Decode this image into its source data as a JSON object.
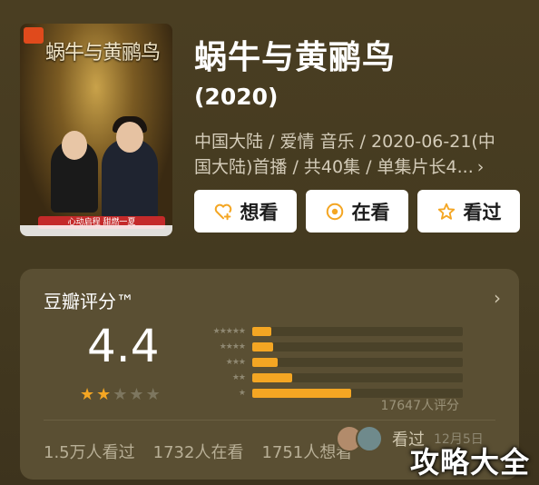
{
  "movie": {
    "title": "蜗牛与黄鹂鸟",
    "year": "(2020)",
    "meta_line1": "中国大陆 / 爱情 音乐 / 2020-06-21(中",
    "meta_line2": "国大陆)首播 / 共40集 / 单集片长4...",
    "meta_more_icon": "chevron-right-icon",
    "poster": {
      "title_text": "蜗牛与黄鹂鸟",
      "tagline": "心动启程 甜燃一夏"
    }
  },
  "actions": [
    {
      "label": "想看",
      "icon": "heart-plus-icon"
    },
    {
      "label": "在看",
      "icon": "target-icon"
    },
    {
      "label": "看过",
      "icon": "star-outline-icon"
    }
  ],
  "rating": {
    "title": "豆瓣评分™",
    "score": "4.4",
    "stars_filled": 2,
    "stars_total": 5,
    "distribution": [
      {
        "stars": 5,
        "fraction": 0.09
      },
      {
        "stars": 4,
        "fraction": 0.1
      },
      {
        "stars": 3,
        "fraction": 0.12
      },
      {
        "stars": 2,
        "fraction": 0.19
      },
      {
        "stars": 1,
        "fraction": 0.47
      }
    ],
    "count": "17647人评分",
    "colors": {
      "accent": "#f4a623"
    }
  },
  "stats": {
    "wished": "1.5万人看过",
    "watching": "1732人在看",
    "wish": "1751人想看"
  },
  "seen": {
    "label": "看过",
    "date": "12月5日"
  },
  "watermark": "攻略大全"
}
